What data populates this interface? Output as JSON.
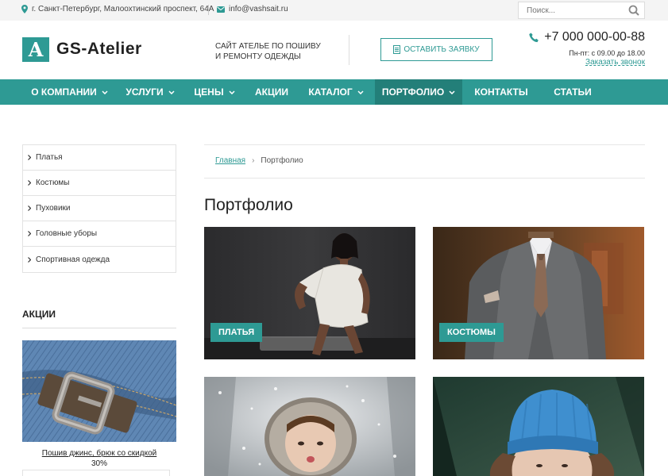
{
  "topbar": {
    "address": "г. Санкт-Петербург, Малоохтинский проспект, 64А",
    "email": "info@vashsait.ru",
    "search_placeholder": "Поиск..."
  },
  "header": {
    "logo_letter": "A",
    "logo_text": "GS-Atelier",
    "tagline_line1": "САЙТ АТЕЛЬЕ ПО ПОШИВУ",
    "tagline_line2": "И РЕМОНТУ ОДЕЖДЫ",
    "order_button": "ОСТАВИТЬ ЗАЯВКУ",
    "phone": "+7 000 000-00-88",
    "hours": "Пн-пт: с 09.00 до 18.00",
    "callback": "Заказать звонок"
  },
  "nav": {
    "items": [
      {
        "label": "О КОМПАНИИ",
        "dropdown": true
      },
      {
        "label": "УСЛУГИ",
        "dropdown": true
      },
      {
        "label": "ЦЕНЫ",
        "dropdown": true
      },
      {
        "label": "АКЦИИ",
        "dropdown": false
      },
      {
        "label": "КАТАЛОГ",
        "dropdown": true
      },
      {
        "label": "ПОРТФОЛИО",
        "dropdown": true,
        "active": true
      },
      {
        "label": "КОНТАКТЫ",
        "dropdown": false
      },
      {
        "label": "СТАТЬИ",
        "dropdown": false
      }
    ]
  },
  "sidebar": {
    "items": [
      {
        "label": "Платья"
      },
      {
        "label": "Костюмы"
      },
      {
        "label": "Пуховики"
      },
      {
        "label": "Головные уборы"
      },
      {
        "label": "Спортивная одежда"
      }
    ],
    "promo_title": "АКЦИИ",
    "promo_link": "Пошив джинс, брюк со скидкой",
    "promo_discount": "30%"
  },
  "breadcrumb": {
    "home": "Главная",
    "separator": "›",
    "current": "Портфолио"
  },
  "main": {
    "title": "Портфолио",
    "cards": [
      {
        "label": "ПЛАТЬЯ"
      },
      {
        "label": "КОСТЮМЫ"
      },
      {
        "label": ""
      },
      {
        "label": ""
      }
    ]
  },
  "colors": {
    "accent": "#2e9a94",
    "accent_dark": "#237f79",
    "topbar_bg": "#f4f4f4"
  }
}
